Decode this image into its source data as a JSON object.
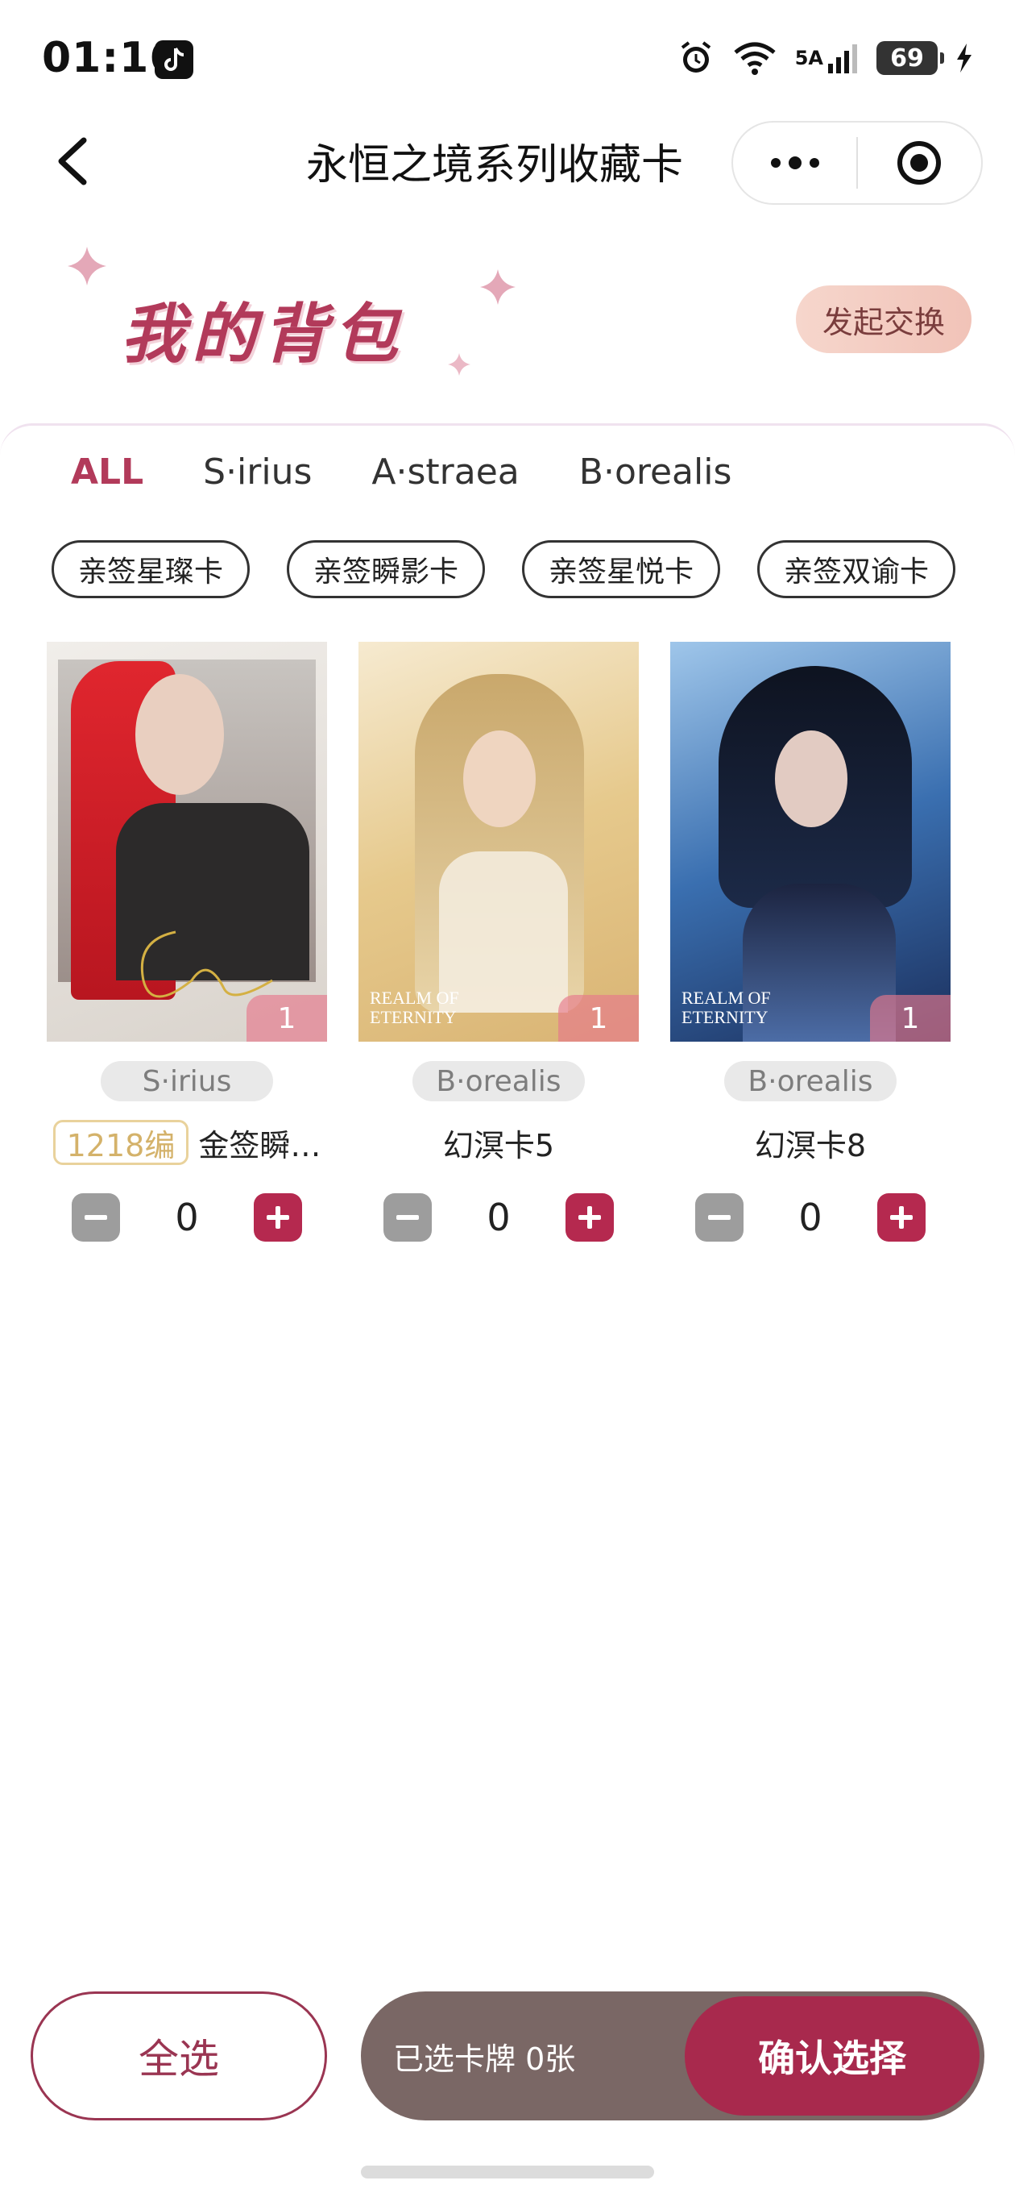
{
  "status_bar": {
    "time": "01:16",
    "network_label": "5A",
    "battery": "69"
  },
  "nav": {
    "title": "永恒之境系列收藏卡"
  },
  "header": {
    "title": "我的背包",
    "trade_button": "发起交换"
  },
  "tabs": [
    {
      "label": "ALL",
      "active": true
    },
    {
      "label": "S·irius",
      "active": false
    },
    {
      "label": "A·straea",
      "active": false
    },
    {
      "label": "B·orealis",
      "active": false
    }
  ],
  "filter_chips": [
    "亲签星璨卡",
    "亲签瞬影卡",
    "亲签星悦卡",
    "亲签双谕卡"
  ],
  "cards": [
    {
      "series": "S·irius",
      "badge": "1218编",
      "name": "金签瞬…",
      "count": "1",
      "quantity": "0",
      "image_text": ""
    },
    {
      "series": "B·orealis",
      "badge": "",
      "name": "幻溟卡5",
      "count": "1",
      "quantity": "0",
      "image_text": "REALM OF ETERNITY"
    },
    {
      "series": "B·orealis",
      "badge": "",
      "name": "幻溟卡8",
      "count": "1",
      "quantity": "0",
      "image_text": "REALM OF ETERNITY"
    }
  ],
  "footer": {
    "select_all": "全选",
    "selected_text": "已选卡牌 0张",
    "confirm": "确认选择"
  },
  "colors": {
    "accent": "#b23a5a",
    "plus_button": "#b5294f",
    "minus_button": "#9d9d9d",
    "summary_bar": "#7a6765"
  }
}
